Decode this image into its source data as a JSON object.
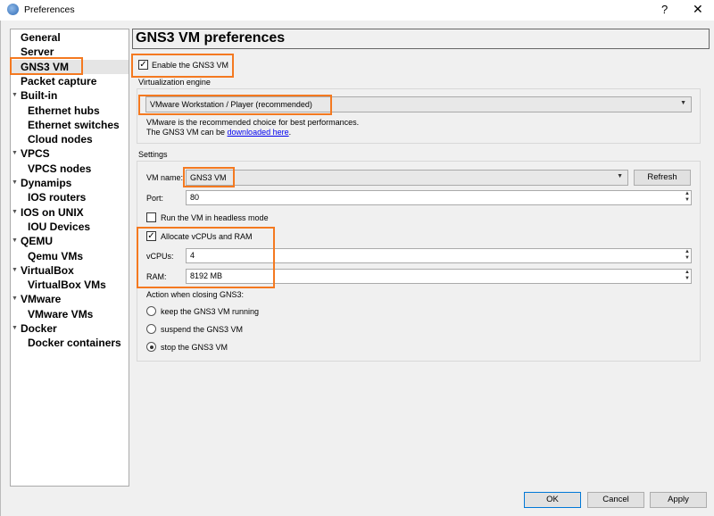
{
  "window": {
    "title": "Preferences",
    "help": "?",
    "close": "✕"
  },
  "sidebar": {
    "items": [
      {
        "label": "General",
        "level": 0
      },
      {
        "label": "Server",
        "level": 0
      },
      {
        "label": "GNS3 VM",
        "level": 0,
        "selected": true
      },
      {
        "label": "Packet capture",
        "level": 0
      },
      {
        "label": "Built-in",
        "level": 0,
        "expanded": true
      },
      {
        "label": "Ethernet hubs",
        "level": 1
      },
      {
        "label": "Ethernet switches",
        "level": 1
      },
      {
        "label": "Cloud nodes",
        "level": 1
      },
      {
        "label": "VPCS",
        "level": 0,
        "expanded": true
      },
      {
        "label": "VPCS nodes",
        "level": 1
      },
      {
        "label": "Dynamips",
        "level": 0,
        "expanded": true
      },
      {
        "label": "IOS routers",
        "level": 1
      },
      {
        "label": "IOS on UNIX",
        "level": 0,
        "expanded": true
      },
      {
        "label": "IOU Devices",
        "level": 1
      },
      {
        "label": "QEMU",
        "level": 0,
        "expanded": true
      },
      {
        "label": "Qemu VMs",
        "level": 1
      },
      {
        "label": "VirtualBox",
        "level": 0,
        "expanded": true
      },
      {
        "label": "VirtualBox VMs",
        "level": 1
      },
      {
        "label": "VMware",
        "level": 0,
        "expanded": true
      },
      {
        "label": "VMware VMs",
        "level": 1
      },
      {
        "label": "Docker",
        "level": 0,
        "expanded": true
      },
      {
        "label": "Docker containers",
        "level": 1
      }
    ]
  },
  "main": {
    "title": "GNS3 VM preferences",
    "enable_label": "Enable the GNS3 VM",
    "enable_checked": true,
    "virt_label": "Virtualization engine",
    "engine": "VMware Workstation / Player (recommended)",
    "engine_desc1": "VMware is the recommended choice for best performances.",
    "engine_desc2_pre": "The GNS3 VM can be ",
    "engine_link": "downloaded here",
    "engine_desc2_post": ".",
    "settings_label": "Settings",
    "vm_name_label": "VM name:",
    "vm_name": "GNS3 VM",
    "refresh": "Refresh",
    "port_label": "Port:",
    "port": "80",
    "headless_label": "Run the VM in headless mode",
    "headless_checked": false,
    "allocate_label": "Allocate vCPUs and RAM",
    "allocate_checked": true,
    "vcpus_label": "vCPUs:",
    "vcpus": "4",
    "ram_label": "RAM:",
    "ram": "8192 MB",
    "action_label": "Action when closing GNS3:",
    "actions": [
      {
        "label": "keep the GNS3 VM running",
        "selected": false
      },
      {
        "label": "suspend the GNS3 VM",
        "selected": false
      },
      {
        "label": "stop the GNS3 VM",
        "selected": true
      }
    ]
  },
  "footer": {
    "ok": "OK",
    "cancel": "Cancel",
    "apply": "Apply"
  }
}
